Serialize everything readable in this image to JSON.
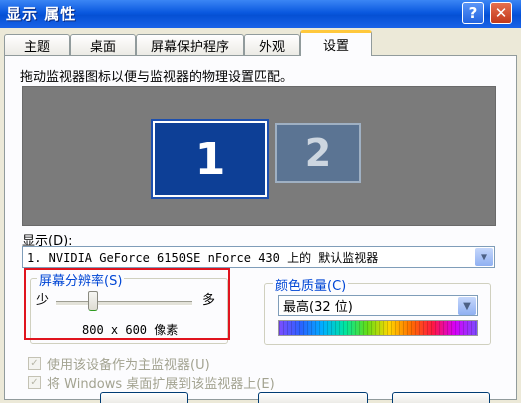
{
  "window": {
    "title": "显示 属性",
    "help_label": "?",
    "close_label": "✕"
  },
  "tabs": [
    {
      "label": "主题"
    },
    {
      "label": "桌面"
    },
    {
      "label": "屏幕保护程序"
    },
    {
      "label": "外观"
    },
    {
      "label": "设置"
    }
  ],
  "active_tab": "设置",
  "instruction": "拖动监视器图标以便与监视器的物理设置匹配。",
  "monitors": [
    {
      "number": "1",
      "selected": true
    },
    {
      "number": "2",
      "selected": false
    }
  ],
  "display": {
    "label": "显示(D):",
    "value": "1. NVIDIA GeForce 6150SE nForce 430 上的 默认监视器"
  },
  "resolution": {
    "legend": "屏幕分辨率(S)",
    "less_label": "少",
    "more_label": "多",
    "value": "800 x 600 像素",
    "slider_position": 0.25
  },
  "color_quality": {
    "legend": "颜色质量(C)",
    "value": "最高(32 位)"
  },
  "checkboxes": [
    {
      "label": "使用该设备作为主监视器(U)",
      "checked": true,
      "enabled": false
    },
    {
      "label": "将 Windows 桌面扩展到该监视器上(E)",
      "checked": true,
      "enabled": false
    }
  ],
  "colors": {
    "accent": "#0046d5",
    "highlight_box": "#e0141e",
    "titlebar": "#0a58df"
  }
}
